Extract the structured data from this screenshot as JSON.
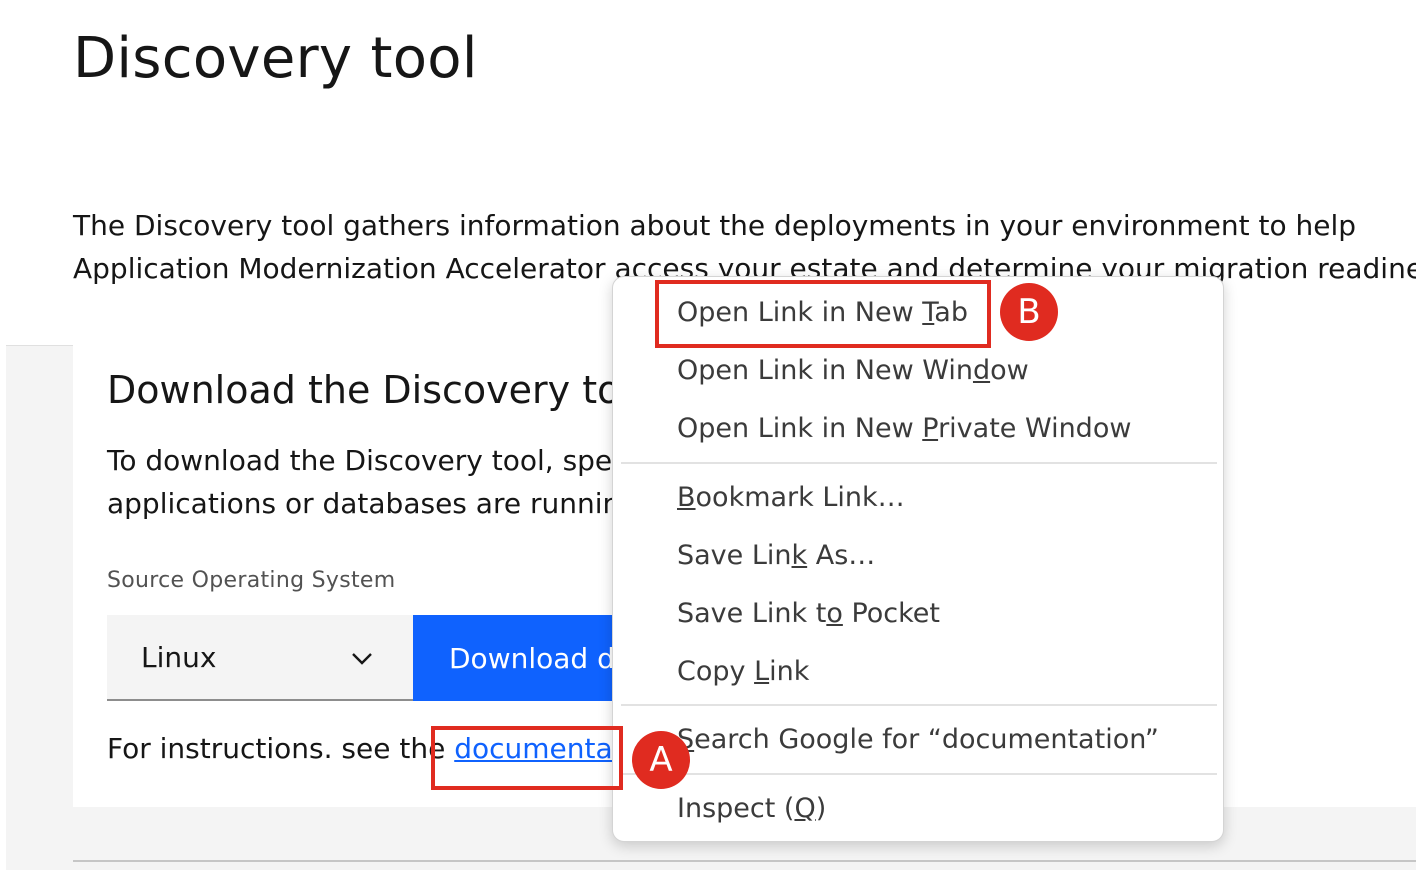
{
  "page": {
    "title": "Discovery tool",
    "intro_line1": "The Discovery tool gathers information about the deployments in your environment to help",
    "intro_line2": "Application Modernization Accelerator access your estate and determine your migration readiness"
  },
  "download_card": {
    "title": "Download the Discovery to",
    "desc_line1": "To download the Discovery tool, spec",
    "desc_line2": "applications or databases are runnin",
    "os_label": "Source Operating System",
    "os_selected": "Linux",
    "download_button": "Download d",
    "instructions_prefix": "For instructions. see the ",
    "doc_link": "documentat"
  },
  "context_menu": {
    "open_new_tab": {
      "pre": "Open Link in New ",
      "key": "T",
      "post": "ab"
    },
    "open_new_window": {
      "pre": "Open Link in New Win",
      "key": "d",
      "post": "ow"
    },
    "open_private": {
      "pre": "Open Link in New ",
      "key": "P",
      "post": "rivate Window"
    },
    "bookmark": {
      "pre": "",
      "key": "B",
      "post": "ookmark Link…"
    },
    "save_as": {
      "pre": "Save Lin",
      "key": "k",
      "post": " As…"
    },
    "save_pocket": {
      "pre": "Save Link t",
      "key": "o",
      "post": " Pocket"
    },
    "copy_link": {
      "pre": "Copy ",
      "key": "L",
      "post": "ink"
    },
    "search_google": {
      "pre": "",
      "key": "S",
      "post": "earch Google for “documentation”"
    },
    "inspect": {
      "pre": "Inspect (",
      "key": "Q",
      "post": ")"
    }
  },
  "annotations": {
    "badge_a": "A",
    "badge_b": "B",
    "color": "#e02b20"
  },
  "colors": {
    "primary_button": "#0f62fe",
    "link": "#0f62fe",
    "background_band": "#f4f4f4"
  },
  "icons": {
    "dropdown": "chevron-down-icon"
  }
}
